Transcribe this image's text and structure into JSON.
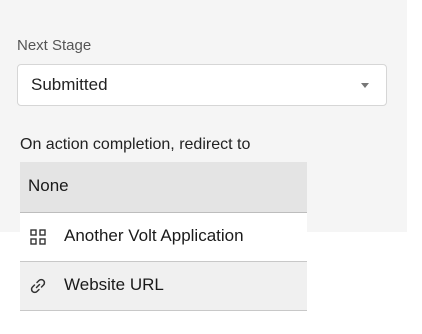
{
  "next_stage": {
    "label": "Next Stage",
    "selected_value": "Submitted"
  },
  "redirect": {
    "label": "On action completion, redirect to",
    "options": [
      {
        "label": "None",
        "icon": null,
        "selected": true
      },
      {
        "label": "Another Volt Application",
        "icon": "app-grid-icon",
        "selected": false
      },
      {
        "label": "Website URL",
        "icon": "link-icon",
        "selected": false
      }
    ]
  }
}
